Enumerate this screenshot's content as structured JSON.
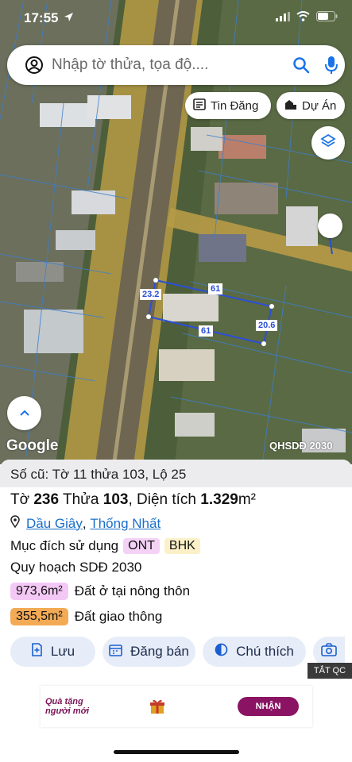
{
  "status": {
    "time": "17:55"
  },
  "search": {
    "placeholder": "Nhập tờ thửa, tọa độ...."
  },
  "chips": {
    "news": "Tin Đăng",
    "project": "Dự Án"
  },
  "map": {
    "dimensions": {
      "top": "61",
      "left": "23.2",
      "bottom": "61",
      "right": "20.6"
    },
    "watermark": "Google",
    "overlay_label": "QHSDĐ 2030"
  },
  "parcel": {
    "old_info": "Số cũ: Tờ 11 thửa 103, Lộ 25",
    "title_prefix": "Tờ ",
    "sheet": "236",
    "parcel_word": " Thửa ",
    "parcel_no": "103",
    "area_word": ", Diện tích ",
    "area": "1.329",
    "area_unit": "m²",
    "location_district": "Dầu Giây",
    "location_commune": "Thống Nhất",
    "location_sep": ",",
    "purpose_label": "Mục đích sử dụng",
    "purpose_tags": [
      "ONT",
      "BHK"
    ],
    "plan_label": "Quy hoạch SDĐ 2030",
    "plan_areas": [
      {
        "value": "973,6m²",
        "label": "Đất ở tại nông thôn",
        "color": "#f4c8f5"
      },
      {
        "value": "355,5m²",
        "label": "Đất giao thông",
        "color": "#f2aa55"
      }
    ]
  },
  "actions": {
    "save": "Lưu",
    "post": "Đăng bán",
    "note": "Chú thích"
  },
  "ad": {
    "tag": "TẮT QC",
    "slogan_line1": "Quà tặng",
    "slogan_line2": "người mới",
    "cta": "NHẬN"
  }
}
